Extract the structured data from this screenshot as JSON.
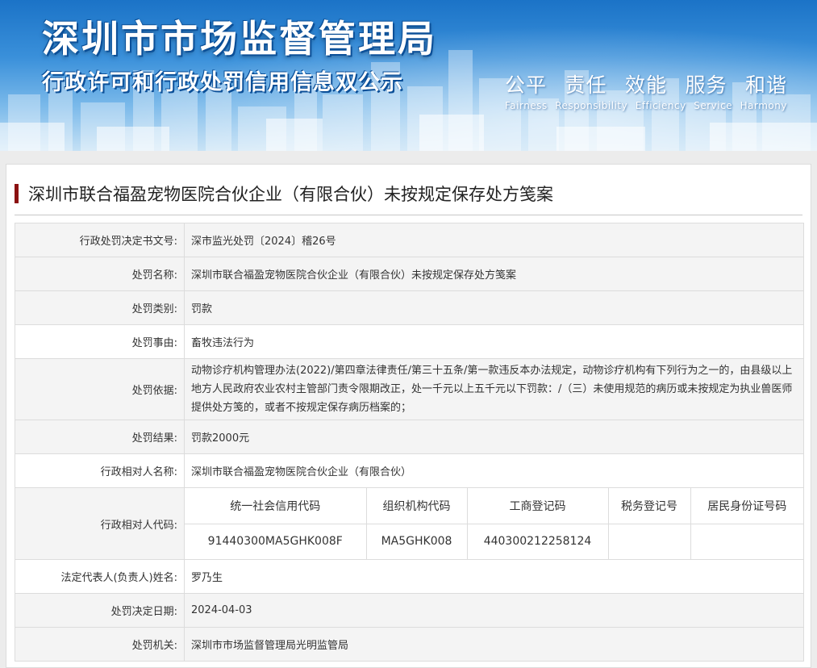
{
  "banner": {
    "title": "深圳市市场监督管理局",
    "subtitle": "行政许可和行政处罚信用信息双公示",
    "slogans": [
      {
        "zh": "公平",
        "en": "Fairness"
      },
      {
        "zh": "责任",
        "en": "Responsibility"
      },
      {
        "zh": "效能",
        "en": "Efficiency"
      },
      {
        "zh": "服务",
        "en": "Service"
      },
      {
        "zh": "和谐",
        "en": "Harmony"
      }
    ]
  },
  "case": {
    "title": "深圳市联合福盈宠物医院合伙企业（有限合伙）未按规定保存处方笺案"
  },
  "rows": [
    {
      "label": "行政处罚决定书文号:",
      "value": "深市监光处罚〔2024〕稽26号"
    },
    {
      "label": "处罚名称:",
      "value": "深圳市联合福盈宠物医院合伙企业（有限合伙）未按规定保存处方笺案"
    },
    {
      "label": "处罚类别:",
      "value": "罚款"
    },
    {
      "label": "处罚事由:",
      "value": "畜牧违法行为"
    },
    {
      "label": "处罚依据:",
      "value": "动物诊疗机构管理办法(2022)/第四章法律责任/第三十五条/第一款违反本办法规定，动物诊疗机构有下列行为之一的，由县级以上地方人民政府农业农村主管部门责令限期改正，处一千元以上五千元以下罚款：/（三）未使用规范的病历或未按规定为执业兽医师提供处方笺的，或者不按规定保存病历档案的；"
    },
    {
      "label": "处罚结果:",
      "value": "罚款2000元"
    },
    {
      "label": "行政相对人名称:",
      "value": "深圳市联合福盈宠物医院合伙企业（有限合伙）"
    }
  ],
  "codes": {
    "label": "行政相对人代码:",
    "headers": [
      "统一社会信用代码",
      "组织机构代码",
      "工商登记码",
      "税务登记号",
      "居民身份证号码"
    ],
    "values": [
      "91440300MA5GHK008F",
      "MA5GHK008",
      "440300212258124",
      "",
      ""
    ]
  },
  "rows_after": [
    {
      "label": "法定代表人(负责人)姓名:",
      "value": "罗乃生"
    },
    {
      "label": "处罚决定日期:",
      "value": "2024-04-03"
    },
    {
      "label": "处罚机关:",
      "value": "深圳市市场监督管理局光明监管局"
    }
  ]
}
